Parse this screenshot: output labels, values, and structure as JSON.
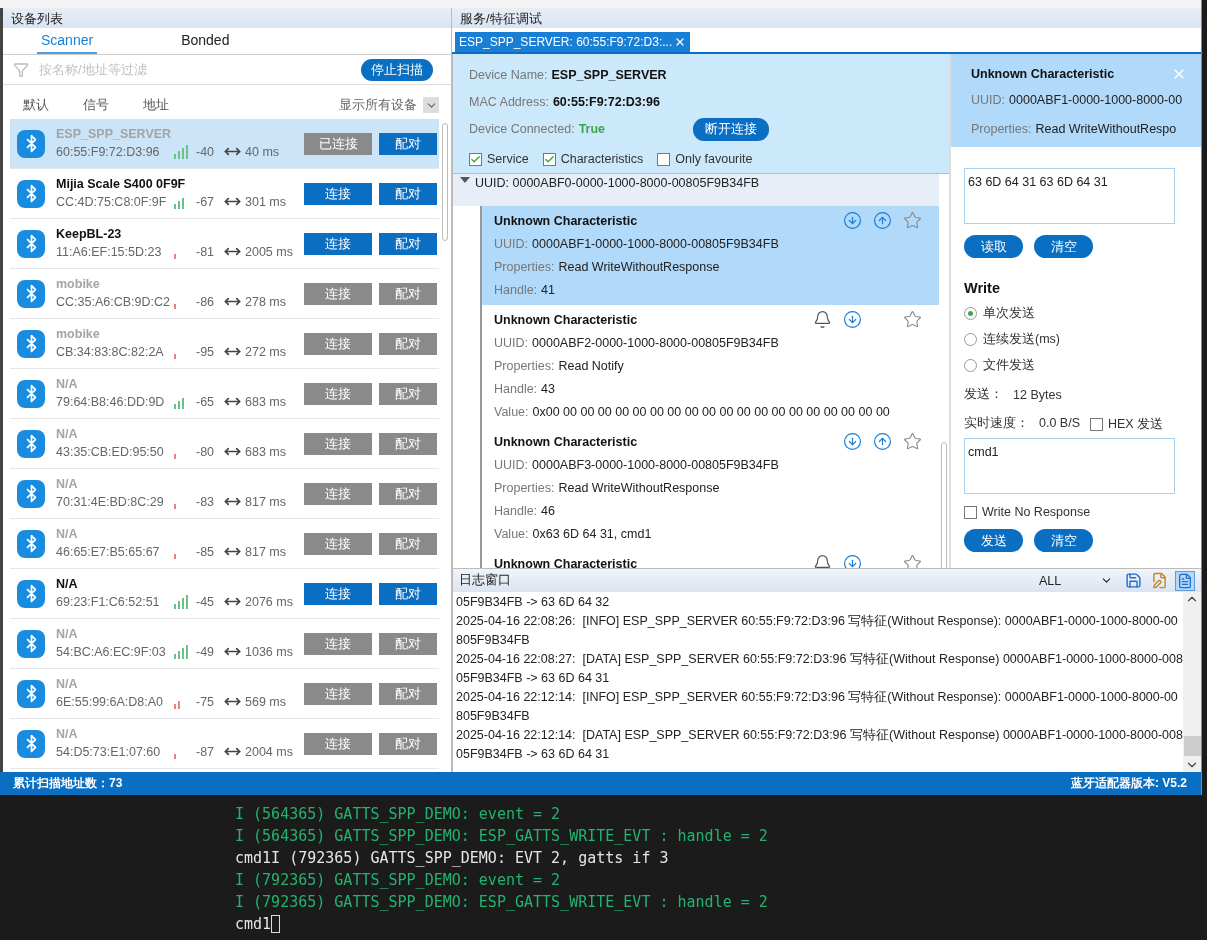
{
  "device_panel": {
    "title": "设备列表",
    "tabs": [
      {
        "label": "Scanner",
        "selected": true
      },
      {
        "label": "Bonded",
        "selected": false
      }
    ],
    "filter": {
      "placeholder": "按名称/地址等过滤"
    },
    "stop_button": "停止扫描",
    "sort_options": [
      "默认",
      "信号",
      "地址"
    ],
    "show_filter": "显示所有设备",
    "devices": [
      {
        "name": "ESP_SPP_SERVER",
        "address": "60:55:F9:72:D3:96",
        "rssi": "-40",
        "interval": "40 ms",
        "selected": true,
        "dimmed": true,
        "connect": {
          "label": "已连接",
          "disabled": true
        },
        "pair": {
          "label": "配对",
          "disabled": false
        }
      },
      {
        "name": "Mijia Scale S400 0F9F",
        "address": "CC:4D:75:C8:0F:9F",
        "rssi": "-67",
        "interval": "301 ms",
        "selected": false,
        "dimmed": false,
        "connect": {
          "label": "连接",
          "disabled": false
        },
        "pair": {
          "label": "配对",
          "disabled": false
        }
      },
      {
        "name": "KeepBL-23",
        "address": "11:A6:EF:15:5D:23",
        "rssi": "-81",
        "interval": "2005 ms",
        "selected": false,
        "dimmed": false,
        "connect": {
          "label": "连接",
          "disabled": false
        },
        "pair": {
          "label": "配对",
          "disabled": false
        }
      },
      {
        "name": "mobike",
        "address": "CC:35:A6:CB:9D:C2",
        "rssi": "-86",
        "interval": "278 ms",
        "selected": false,
        "dimmed": true,
        "connect": {
          "label": "连接",
          "disabled": true
        },
        "pair": {
          "label": "配对",
          "disabled": true
        }
      },
      {
        "name": "mobike",
        "address": "CB:34:83:8C:82:2A",
        "rssi": "-95",
        "interval": "272 ms",
        "selected": false,
        "dimmed": true,
        "connect": {
          "label": "连接",
          "disabled": true
        },
        "pair": {
          "label": "配对",
          "disabled": true
        }
      },
      {
        "name": "N/A",
        "address": "79:64:B8:46:DD:9D",
        "rssi": "-65",
        "interval": "683 ms",
        "selected": false,
        "dimmed": true,
        "connect": {
          "label": "连接",
          "disabled": true
        },
        "pair": {
          "label": "配对",
          "disabled": true
        }
      },
      {
        "name": "N/A",
        "address": "43:35:CB:ED:95:50",
        "rssi": "-80",
        "interval": "683 ms",
        "selected": false,
        "dimmed": true,
        "connect": {
          "label": "连接",
          "disabled": true
        },
        "pair": {
          "label": "配对",
          "disabled": true
        }
      },
      {
        "name": "N/A",
        "address": "70:31:4E:BD:8C:29",
        "rssi": "-83",
        "interval": "817 ms",
        "selected": false,
        "dimmed": true,
        "connect": {
          "label": "连接",
          "disabled": true
        },
        "pair": {
          "label": "配对",
          "disabled": true
        }
      },
      {
        "name": "N/A",
        "address": "46:65:E7:B5:65:67",
        "rssi": "-85",
        "interval": "817 ms",
        "selected": false,
        "dimmed": true,
        "connect": {
          "label": "连接",
          "disabled": true
        },
        "pair": {
          "label": "配对",
          "disabled": true
        }
      },
      {
        "name": "N/A",
        "address": "69:23:F1:C6:52:51",
        "rssi": "-45",
        "interval": "2076 ms",
        "selected": false,
        "dimmed": false,
        "connect": {
          "label": "连接",
          "disabled": false
        },
        "pair": {
          "label": "配对",
          "disabled": false
        }
      },
      {
        "name": "N/A",
        "address": "54:BC:A6:EC:9F:03",
        "rssi": "-49",
        "interval": "1036 ms",
        "selected": false,
        "dimmed": true,
        "connect": {
          "label": "连接",
          "disabled": true
        },
        "pair": {
          "label": "配对",
          "disabled": true
        }
      },
      {
        "name": "N/A",
        "address": "6E:55:99:6A:D8:A0",
        "rssi": "-75",
        "interval": "569 ms",
        "selected": false,
        "dimmed": true,
        "connect": {
          "label": "连接",
          "disabled": true
        },
        "pair": {
          "label": "配对",
          "disabled": true
        }
      },
      {
        "name": "N/A",
        "address": "54:D5:73:E1:07:60",
        "rssi": "-87",
        "interval": "2004 ms",
        "selected": false,
        "dimmed": true,
        "connect": {
          "label": "连接",
          "disabled": true
        },
        "pair": {
          "label": "配对",
          "disabled": true
        }
      }
    ]
  },
  "service_panel": {
    "title": "服务/特征调试",
    "tabs": [
      {
        "label": "ESP_SPP_SERVER: 60:55:F9:72:D3:...",
        "selected": true
      }
    ],
    "device_info": [
      {
        "label": "Device Name:",
        "value": "ESP_SPP_SERVER",
        "kind": "text"
      },
      {
        "label": "MAC Address:",
        "value": "60:55:F9:72:D3:96",
        "kind": "text"
      },
      {
        "label": "Device Connected:",
        "value": "True",
        "kind": "status"
      }
    ],
    "disconnect_button": "断开连接",
    "view_filters": [
      {
        "label": "Service",
        "checked": true
      },
      {
        "label": "Characteristics",
        "checked": true
      },
      {
        "label": "Only favourite",
        "checked": false
      }
    ],
    "service": {
      "uuid": "UUID: 0000ABF0-0000-1000-8000-00805F9B34FB",
      "expanded": true
    },
    "characteristics": [
      {
        "name": "Unknown Characteristic",
        "selected": true,
        "favourite": false,
        "notify": false,
        "read": true,
        "write": true,
        "fields": [
          {
            "label": "UUID:",
            "value": "0000ABF1-0000-1000-8000-00805F9B34FB"
          },
          {
            "label": "Properties:",
            "value": "Read WriteWithoutResponse"
          },
          {
            "label": "Handle:",
            "value": "41"
          }
        ]
      },
      {
        "name": "Unknown Characteristic",
        "selected": false,
        "favourite": false,
        "notify": true,
        "read": true,
        "write": false,
        "fields": [
          {
            "label": "UUID:",
            "value": "0000ABF2-0000-1000-8000-00805F9B34FB"
          },
          {
            "label": "Properties:",
            "value": "Read Notify"
          },
          {
            "label": "Handle:",
            "value": "43"
          },
          {
            "label": "Value:",
            "value": "0x00 00 00 00 00 00 00 00 00 00 00 00 00 00 00 00 00 00 00 00"
          }
        ]
      },
      {
        "name": "Unknown Characteristic",
        "selected": false,
        "favourite": false,
        "notify": false,
        "read": true,
        "write": true,
        "fields": [
          {
            "label": "UUID:",
            "value": "0000ABF3-0000-1000-8000-00805F9B34FB"
          },
          {
            "label": "Properties:",
            "value": "Read WriteWithoutResponse"
          },
          {
            "label": "Handle:",
            "value": "46"
          },
          {
            "label": "Value:",
            "value": "0x63 6D 64 31, cmd1"
          }
        ]
      },
      {
        "name": "Unknown Characteristic",
        "selected": false,
        "favourite": false,
        "notify": true,
        "read": true,
        "write": false
      }
    ],
    "detail": {
      "name": "Unknown Characteristic",
      "fields": [
        {
          "label": "UUID:",
          "value": "0000ABF1-0000-1000-8000-00"
        },
        {
          "label": "Properties:",
          "value": "Read WriteWithoutRespo"
        }
      ],
      "read_value": "63 6D 64 31 63 6D 64 31",
      "read_buttons": [
        "读取",
        "清空"
      ],
      "write_title": "Write",
      "modes": [
        {
          "label": "单次发送",
          "selected": true
        },
        {
          "label": "连续发送(ms)",
          "selected": false
        },
        {
          "label": "文件发送",
          "selected": false
        }
      ],
      "sent_label": "发送：",
      "sent_value": "12 Bytes",
      "speed_label": "实时速度：",
      "speed_value": "0.0 B/S",
      "hex_send": {
        "label": "HEX 发送",
        "checked": false
      },
      "write_value": "cmd1",
      "write_no_response": {
        "label": "Write No Response",
        "checked": false
      },
      "write_buttons": [
        "发送",
        "清空"
      ]
    }
  },
  "log_panel": {
    "title": "日志窗口",
    "level": "ALL",
    "lines": [
      "05F9B34FB -> 63 6D 64 32",
      "2025-04-16 22:08:26:  [INFO] ESP_SPP_SERVER 60:55:F9:72:D3:96 写特征(Without Response): 0000ABF1-0000-1000-8000-00",
      "805F9B34FB",
      "2025-04-16 22:08:27:  [DATA] ESP_SPP_SERVER 60:55:F9:72:D3:96 写特征(Without Response) 0000ABF1-0000-1000-8000-008",
      "05F9B34FB -> 63 6D 64 31",
      "2025-04-16 22:12:14:  [INFO] ESP_SPP_SERVER 60:55:F9:72:D3:96 写特征(Without Response): 0000ABF1-0000-1000-8000-00",
      "805F9B34FB",
      "2025-04-16 22:12:14:  [DATA] ESP_SPP_SERVER 60:55:F9:72:D3:96 写特征(Without Response) 0000ABF1-0000-1000-8000-008",
      "05F9B34FB -> 63 6D 64 31"
    ]
  },
  "status_bar": {
    "scan_count": "累计扫描地址数：73",
    "adapter_version": "蓝牙适配器版本: V5.2"
  },
  "terminal": {
    "lines": [
      {
        "text": "I (564365) GATTS_SPP_DEMO: event = 2",
        "kind": "log"
      },
      {
        "text": "I (564365) GATTS_SPP_DEMO: ESP_GATTS_WRITE_EVT : handle = 2",
        "kind": "log"
      },
      {
        "text": "cmd1I (792365) GATTS_SPP_DEMO: EVT 2, gatts if 3",
        "kind": "plain"
      },
      {
        "text": "I (792365) GATTS_SPP_DEMO: event = 2",
        "kind": "log"
      },
      {
        "text": "I (792365) GATTS_SPP_DEMO: ESP_GATTS_WRITE_EVT : handle = 2",
        "kind": "log"
      },
      {
        "text": "cmd1",
        "kind": "plain"
      }
    ],
    "cursor": true
  }
}
